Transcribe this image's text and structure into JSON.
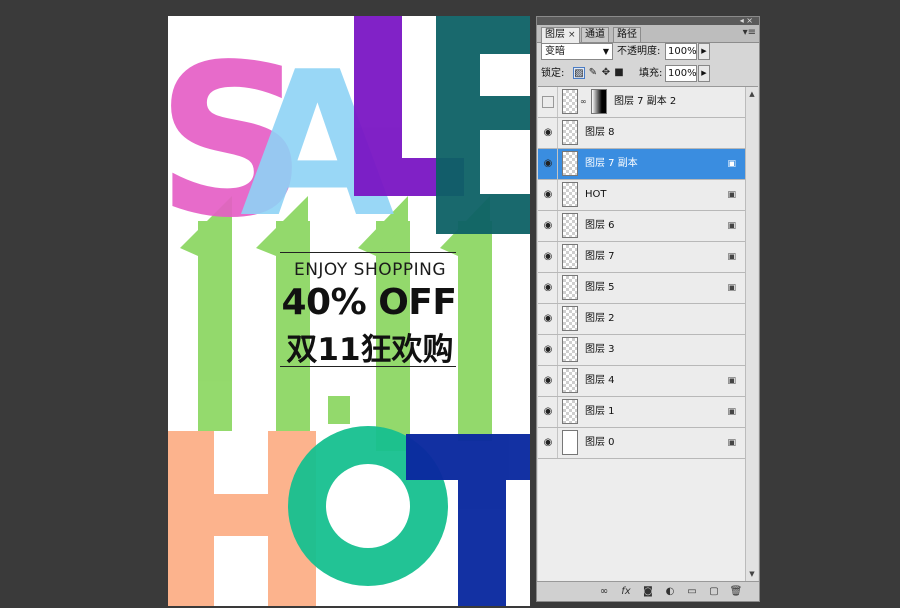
{
  "poster": {
    "letters_top": [
      "S",
      "A",
      "L",
      "E"
    ],
    "letters_bottom": [
      "H",
      "O",
      "T"
    ],
    "enjoy": "ENJOY SHOPPING",
    "discount": "40% OFF",
    "chinese": "双11狂欢购",
    "colors": {
      "pink": "#e55fc6",
      "light_blue": "#8fd3f6",
      "purple": "#7a16c4",
      "teal": "#0d6166",
      "green": "#8ed865",
      "peach": "#fcb38d",
      "emerald": "#16c08f",
      "navy": "#0b2aa0"
    }
  },
  "panel": {
    "tabs": [
      {
        "label": "图层",
        "close": "×"
      },
      {
        "label": "通道"
      },
      {
        "label": "路径"
      }
    ],
    "menu_icon": "▾≡",
    "blend_mode": "变暗",
    "opacity_label": "不透明度:",
    "opacity_value": "100%",
    "lock_label": "锁定:",
    "fill_label": "填充:",
    "fill_value": "100%",
    "layers": [
      {
        "name": "图层 7 副本 2",
        "visible": false,
        "selected": false,
        "locked": false,
        "mask": true
      },
      {
        "name": "图层 8",
        "visible": true,
        "selected": false,
        "locked": false,
        "mask": false
      },
      {
        "name": "图层 7 副本",
        "visible": true,
        "selected": true,
        "locked": true,
        "mask": false
      },
      {
        "name": "HOT",
        "visible": true,
        "selected": false,
        "locked": true,
        "mask": false
      },
      {
        "name": "图层 6",
        "visible": true,
        "selected": false,
        "locked": true,
        "mask": false
      },
      {
        "name": "图层 7",
        "visible": true,
        "selected": false,
        "locked": true,
        "mask": false
      },
      {
        "name": "图层 5",
        "visible": true,
        "selected": false,
        "locked": true,
        "mask": false
      },
      {
        "name": "图层 2",
        "visible": true,
        "selected": false,
        "locked": false,
        "mask": false
      },
      {
        "name": "图层 3",
        "visible": true,
        "selected": false,
        "locked": false,
        "mask": false
      },
      {
        "name": "图层 4",
        "visible": true,
        "selected": false,
        "locked": true,
        "mask": false
      },
      {
        "name": "图层 1",
        "visible": true,
        "selected": false,
        "locked": true,
        "mask": false
      },
      {
        "name": "图层 0",
        "visible": true,
        "selected": false,
        "locked": true,
        "mask": false,
        "plain": true
      }
    ],
    "bottom_icons": [
      "link-layers-icon",
      "fx-icon",
      "add-mask-icon",
      "adjustment-layer-icon",
      "new-group-icon",
      "new-layer-icon",
      "trash-icon"
    ]
  }
}
